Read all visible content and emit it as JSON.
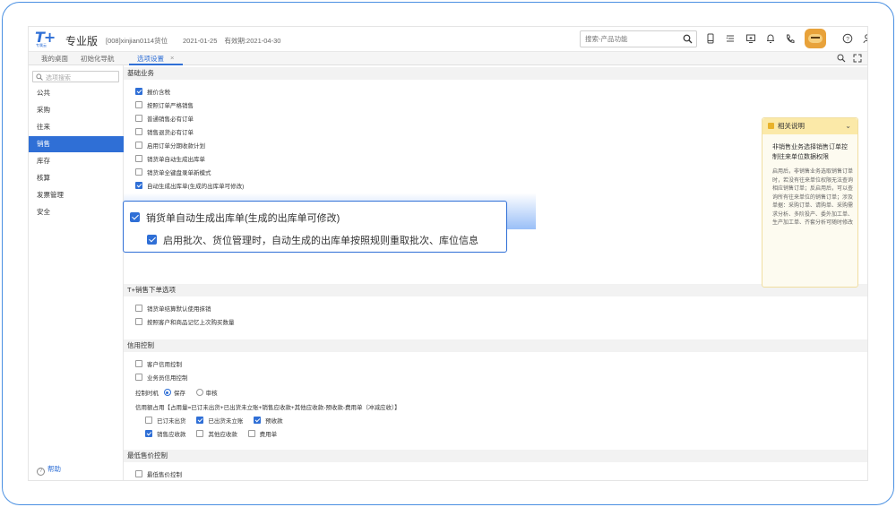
{
  "header": {
    "logo_text": "T+",
    "logo_sub": "专属云",
    "edition": "专业版",
    "account": "[008]xinjian0114货位",
    "date": "2021-01-25",
    "expiry": "有效期:2021-04-30",
    "search_placeholder": "搜索-产品功能"
  },
  "tabs": {
    "desktop": "我的桌面",
    "guide": "初始化导航",
    "options": "选项设置",
    "close": "×"
  },
  "sidebar": {
    "search_placeholder": "选项搜索",
    "items": [
      "公共",
      "采购",
      "往来",
      "销售",
      "库存",
      "核算",
      "发票管理",
      "安全"
    ],
    "active_index": 3,
    "help": "帮助"
  },
  "main": {
    "basic": {
      "title": "基础业务",
      "options": [
        {
          "label": "报价含税",
          "checked": true
        },
        {
          "label": "按照订单严格销售",
          "checked": false
        },
        {
          "label": "普通销售必有订单",
          "checked": false
        },
        {
          "label": "销售退货必有订单",
          "checked": false
        },
        {
          "label": "启用订单分期收款计划",
          "checked": false
        },
        {
          "label": "销货单自动生成出库单",
          "checked": false
        },
        {
          "label": "销货单全键盘录单新模式",
          "checked": false
        },
        {
          "label": "自动生成出库单(生成的出库单可修改)",
          "checked": true
        }
      ]
    },
    "zoom": {
      "option1": "销货单自动生成出库单(生成的出库单可修改)",
      "option2": "启用批次、货位管理时，自动生成的出库单按照规则重取批次、库位信息"
    },
    "tplus": {
      "title": "T+销售下单选项",
      "options": [
        {
          "label": "销货单结算默认使用抹销",
          "checked": false
        },
        {
          "label": "按照客户和商品记忆上次购买数量",
          "checked": false
        }
      ]
    },
    "credit": {
      "title": "信用控制",
      "options": [
        {
          "label": "客户信用控制",
          "checked": false
        },
        {
          "label": "业务员信用控制",
          "checked": false
        }
      ],
      "timing_label": "控制时机",
      "timing_save": "保存",
      "timing_review": "审核",
      "formula": "信用额占用【占用量=已订未出货+已出货未立账+销售应收款+其他应收款-预收款-费用单（冲减应收）】",
      "row1": [
        {
          "label": "已订未出货",
          "checked": false
        },
        {
          "label": "已出货未立账",
          "checked": true
        },
        {
          "label": "预收款",
          "checked": true
        }
      ],
      "row2": [
        {
          "label": "销售应收款",
          "checked": true
        },
        {
          "label": "其他应收款",
          "checked": false
        },
        {
          "label": "费用单",
          "checked": false
        }
      ]
    },
    "minprice": {
      "title": "最低售价控制",
      "option": "最低售价控制"
    }
  },
  "help_panel": {
    "title": "相关说明",
    "heading": "非销售业务选择销售订单控制往来单位数据权限",
    "body": "启用后，非销售业务选取销售订单时，若没有往来单位权限无法查询相应销售订单；反启用后，可以查询所有往来单位的销售订单；涉及单据：采购订单、请购单、采购需求分析、多阶投产、委外加工单、生产加工单、齐套分析可随时修改"
  },
  "colors": {
    "accent": "#2f6fd6",
    "help_bg": "#fdfbf0",
    "help_head": "#fbe9a8"
  }
}
